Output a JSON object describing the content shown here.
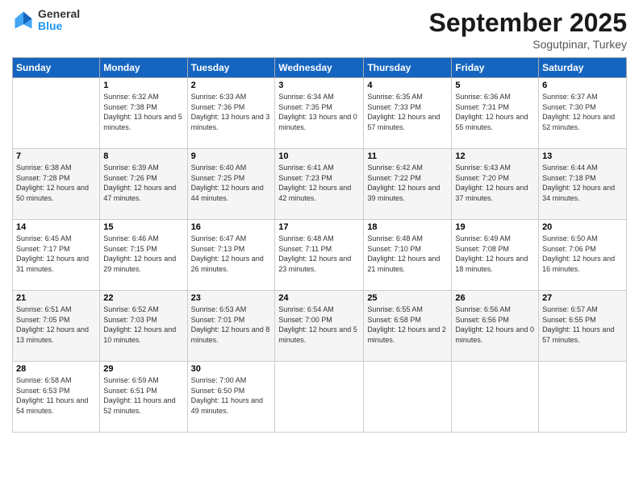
{
  "header": {
    "logo_text_general": "General",
    "logo_text_blue": "Blue",
    "month_title": "September 2025",
    "subtitle": "Sogutpinar, Turkey"
  },
  "days_of_week": [
    "Sunday",
    "Monday",
    "Tuesday",
    "Wednesday",
    "Thursday",
    "Friday",
    "Saturday"
  ],
  "weeks": [
    [
      {
        "day": "",
        "sunrise": "",
        "sunset": "",
        "daylight": ""
      },
      {
        "day": "1",
        "sunrise": "Sunrise: 6:32 AM",
        "sunset": "Sunset: 7:38 PM",
        "daylight": "Daylight: 13 hours and 5 minutes."
      },
      {
        "day": "2",
        "sunrise": "Sunrise: 6:33 AM",
        "sunset": "Sunset: 7:36 PM",
        "daylight": "Daylight: 13 hours and 3 minutes."
      },
      {
        "day": "3",
        "sunrise": "Sunrise: 6:34 AM",
        "sunset": "Sunset: 7:35 PM",
        "daylight": "Daylight: 13 hours and 0 minutes."
      },
      {
        "day": "4",
        "sunrise": "Sunrise: 6:35 AM",
        "sunset": "Sunset: 7:33 PM",
        "daylight": "Daylight: 12 hours and 57 minutes."
      },
      {
        "day": "5",
        "sunrise": "Sunrise: 6:36 AM",
        "sunset": "Sunset: 7:31 PM",
        "daylight": "Daylight: 12 hours and 55 minutes."
      },
      {
        "day": "6",
        "sunrise": "Sunrise: 6:37 AM",
        "sunset": "Sunset: 7:30 PM",
        "daylight": "Daylight: 12 hours and 52 minutes."
      }
    ],
    [
      {
        "day": "7",
        "sunrise": "Sunrise: 6:38 AM",
        "sunset": "Sunset: 7:28 PM",
        "daylight": "Daylight: 12 hours and 50 minutes."
      },
      {
        "day": "8",
        "sunrise": "Sunrise: 6:39 AM",
        "sunset": "Sunset: 7:26 PM",
        "daylight": "Daylight: 12 hours and 47 minutes."
      },
      {
        "day": "9",
        "sunrise": "Sunrise: 6:40 AM",
        "sunset": "Sunset: 7:25 PM",
        "daylight": "Daylight: 12 hours and 44 minutes."
      },
      {
        "day": "10",
        "sunrise": "Sunrise: 6:41 AM",
        "sunset": "Sunset: 7:23 PM",
        "daylight": "Daylight: 12 hours and 42 minutes."
      },
      {
        "day": "11",
        "sunrise": "Sunrise: 6:42 AM",
        "sunset": "Sunset: 7:22 PM",
        "daylight": "Daylight: 12 hours and 39 minutes."
      },
      {
        "day": "12",
        "sunrise": "Sunrise: 6:43 AM",
        "sunset": "Sunset: 7:20 PM",
        "daylight": "Daylight: 12 hours and 37 minutes."
      },
      {
        "day": "13",
        "sunrise": "Sunrise: 6:44 AM",
        "sunset": "Sunset: 7:18 PM",
        "daylight": "Daylight: 12 hours and 34 minutes."
      }
    ],
    [
      {
        "day": "14",
        "sunrise": "Sunrise: 6:45 AM",
        "sunset": "Sunset: 7:17 PM",
        "daylight": "Daylight: 12 hours and 31 minutes."
      },
      {
        "day": "15",
        "sunrise": "Sunrise: 6:46 AM",
        "sunset": "Sunset: 7:15 PM",
        "daylight": "Daylight: 12 hours and 29 minutes."
      },
      {
        "day": "16",
        "sunrise": "Sunrise: 6:47 AM",
        "sunset": "Sunset: 7:13 PM",
        "daylight": "Daylight: 12 hours and 26 minutes."
      },
      {
        "day": "17",
        "sunrise": "Sunrise: 6:48 AM",
        "sunset": "Sunset: 7:11 PM",
        "daylight": "Daylight: 12 hours and 23 minutes."
      },
      {
        "day": "18",
        "sunrise": "Sunrise: 6:48 AM",
        "sunset": "Sunset: 7:10 PM",
        "daylight": "Daylight: 12 hours and 21 minutes."
      },
      {
        "day": "19",
        "sunrise": "Sunrise: 6:49 AM",
        "sunset": "Sunset: 7:08 PM",
        "daylight": "Daylight: 12 hours and 18 minutes."
      },
      {
        "day": "20",
        "sunrise": "Sunrise: 6:50 AM",
        "sunset": "Sunset: 7:06 PM",
        "daylight": "Daylight: 12 hours and 16 minutes."
      }
    ],
    [
      {
        "day": "21",
        "sunrise": "Sunrise: 6:51 AM",
        "sunset": "Sunset: 7:05 PM",
        "daylight": "Daylight: 12 hours and 13 minutes."
      },
      {
        "day": "22",
        "sunrise": "Sunrise: 6:52 AM",
        "sunset": "Sunset: 7:03 PM",
        "daylight": "Daylight: 12 hours and 10 minutes."
      },
      {
        "day": "23",
        "sunrise": "Sunrise: 6:53 AM",
        "sunset": "Sunset: 7:01 PM",
        "daylight": "Daylight: 12 hours and 8 minutes."
      },
      {
        "day": "24",
        "sunrise": "Sunrise: 6:54 AM",
        "sunset": "Sunset: 7:00 PM",
        "daylight": "Daylight: 12 hours and 5 minutes."
      },
      {
        "day": "25",
        "sunrise": "Sunrise: 6:55 AM",
        "sunset": "Sunset: 6:58 PM",
        "daylight": "Daylight: 12 hours and 2 minutes."
      },
      {
        "day": "26",
        "sunrise": "Sunrise: 6:56 AM",
        "sunset": "Sunset: 6:56 PM",
        "daylight": "Daylight: 12 hours and 0 minutes."
      },
      {
        "day": "27",
        "sunrise": "Sunrise: 6:57 AM",
        "sunset": "Sunset: 6:55 PM",
        "daylight": "Daylight: 11 hours and 57 minutes."
      }
    ],
    [
      {
        "day": "28",
        "sunrise": "Sunrise: 6:58 AM",
        "sunset": "Sunset: 6:53 PM",
        "daylight": "Daylight: 11 hours and 54 minutes."
      },
      {
        "day": "29",
        "sunrise": "Sunrise: 6:59 AM",
        "sunset": "Sunset: 6:51 PM",
        "daylight": "Daylight: 11 hours and 52 minutes."
      },
      {
        "day": "30",
        "sunrise": "Sunrise: 7:00 AM",
        "sunset": "Sunset: 6:50 PM",
        "daylight": "Daylight: 11 hours and 49 minutes."
      },
      {
        "day": "",
        "sunrise": "",
        "sunset": "",
        "daylight": ""
      },
      {
        "day": "",
        "sunrise": "",
        "sunset": "",
        "daylight": ""
      },
      {
        "day": "",
        "sunrise": "",
        "sunset": "",
        "daylight": ""
      },
      {
        "day": "",
        "sunrise": "",
        "sunset": "",
        "daylight": ""
      }
    ]
  ]
}
